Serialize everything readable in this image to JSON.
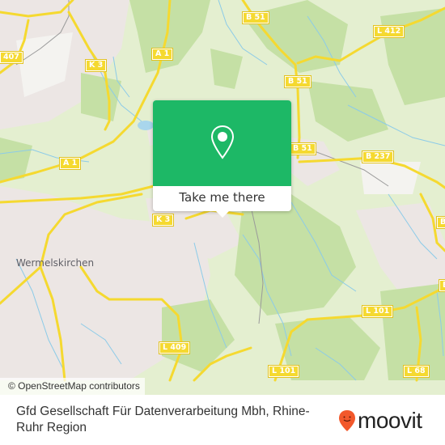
{
  "map": {
    "attribution": "© OpenStreetMap contributors",
    "town_labels": [
      {
        "id": "wermelskirchen",
        "text": "Wermelskirchen"
      }
    ],
    "road_labels": [
      {
        "id": "407",
        "text": "407"
      },
      {
        "id": "k3-north",
        "text": "K 3"
      },
      {
        "id": "a1-north",
        "text": "A 1"
      },
      {
        "id": "a1-south",
        "text": "A 1"
      },
      {
        "id": "b51-north",
        "text": "B 51"
      },
      {
        "id": "b51-mid",
        "text": "B 51"
      },
      {
        "id": "b51-south",
        "text": "B 51"
      },
      {
        "id": "l412",
        "text": "L 412"
      },
      {
        "id": "b237",
        "text": "B 237"
      },
      {
        "id": "k3-south",
        "text": "K 3"
      },
      {
        "id": "l409",
        "text": "L 409"
      },
      {
        "id": "l101-east",
        "text": "L 101"
      },
      {
        "id": "l101-south",
        "text": "L 101"
      },
      {
        "id": "l68",
        "text": "L 68"
      },
      {
        "id": "b-edge-1",
        "text": "B"
      },
      {
        "id": "b-edge-2",
        "text": "B"
      }
    ],
    "colors": {
      "land": "#e4efd0",
      "forest": "#c5e0a5",
      "urban": "#ece6e4",
      "road": "#f5d930",
      "water": "#8ccbe8",
      "popup_green": "#1db866"
    }
  },
  "popup": {
    "icon": "map-pin-icon",
    "button_label": "Take me there"
  },
  "footer": {
    "title": "Gfd Gesellschaft Für Datenverarbeitung Mbh, Rhine-Ruhr Region",
    "logo_text": "moovit",
    "logo_icon": "moovit-pin-icon",
    "logo_color": "#f2582b"
  }
}
